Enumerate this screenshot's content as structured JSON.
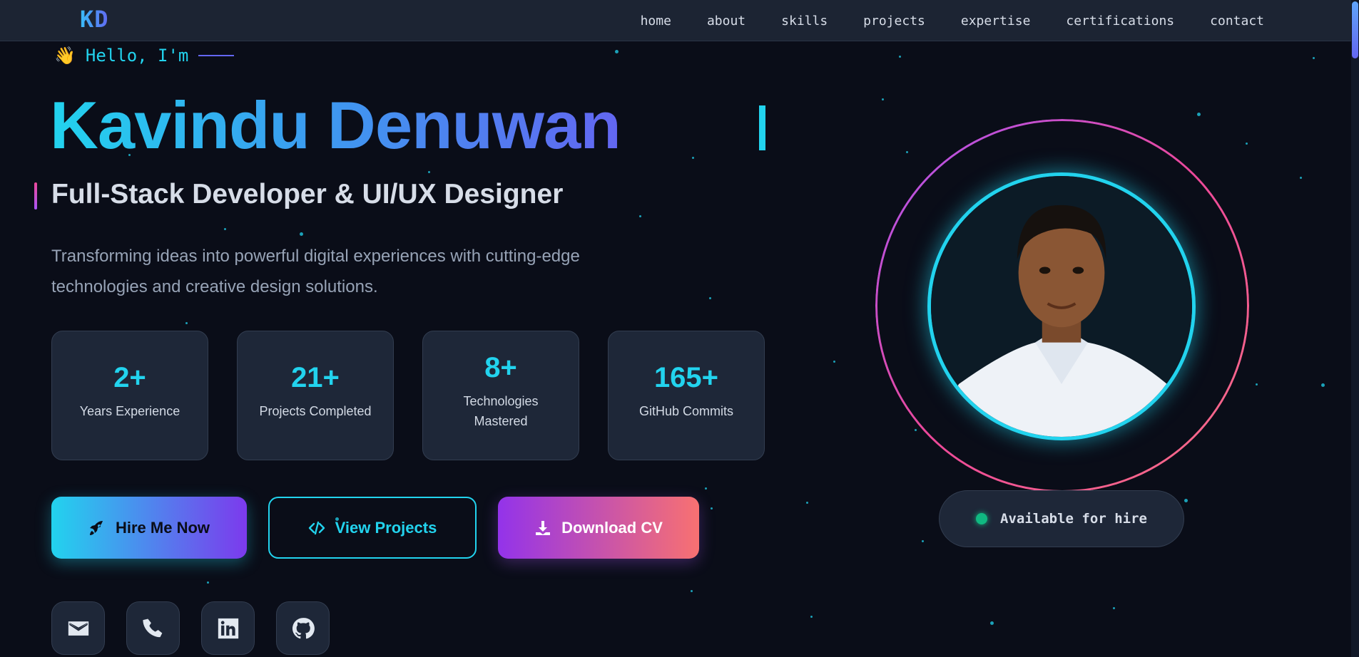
{
  "nav": {
    "logo": "KD",
    "links": [
      "home",
      "about",
      "skills",
      "projects",
      "expertise",
      "certifications",
      "contact"
    ]
  },
  "hero": {
    "greeting_icon": "waving-hand-icon",
    "greeting": "Hello, I'm",
    "name": "Kavindu Denuwan",
    "subtitle": "Full-Stack Developer & UI/UX Designer",
    "description": "Transforming ideas into powerful digital experiences with cutting-edge technologies and creative design solutions.",
    "stats": [
      {
        "value": "2+",
        "label": "Years Experience"
      },
      {
        "value": "21+",
        "label": "Projects Completed"
      },
      {
        "value": "8+",
        "label": "Technologies Mastered"
      },
      {
        "value": "165+",
        "label": "GitHub Commits"
      }
    ],
    "buttons": {
      "hire": "Hire Me Now",
      "projects": "View Projects",
      "cv": "Download CV"
    },
    "socials": [
      "email-icon",
      "phone-icon",
      "linkedin-icon",
      "github-icon"
    ],
    "availability": "Available for hire"
  },
  "colors": {
    "accent": "#22d3ee",
    "indigo": "#6366f1",
    "pink": "#ec4899",
    "purple": "#a855f7",
    "status_green": "#10b981",
    "background": "#0a0d18"
  }
}
